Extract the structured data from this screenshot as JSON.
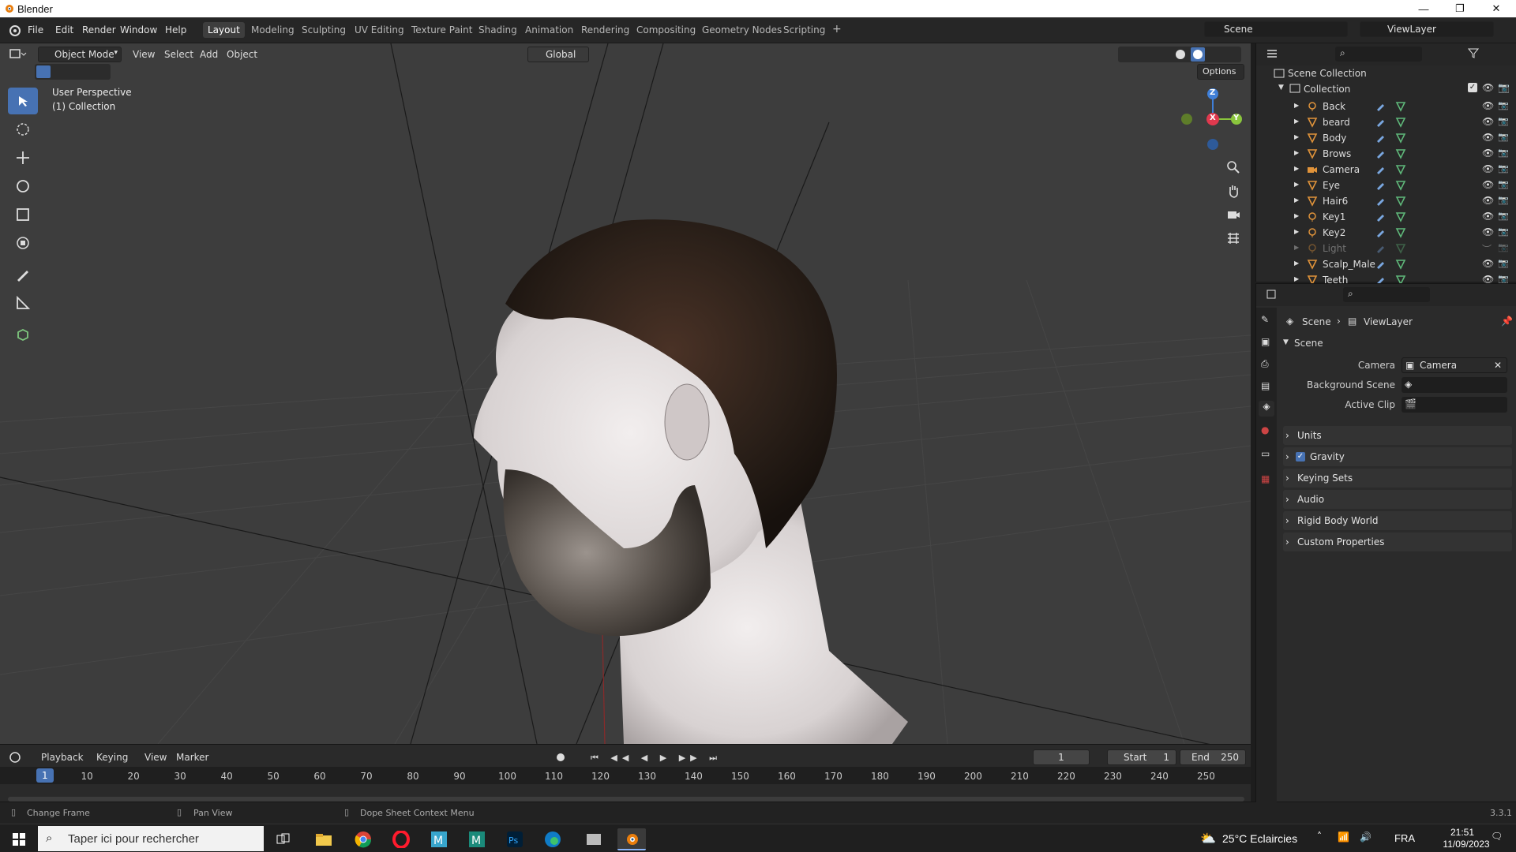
{
  "window": {
    "title": "Blender"
  },
  "menus": [
    "File",
    "Edit",
    "Render",
    "Window",
    "Help"
  ],
  "workspaces": [
    "Layout",
    "Modeling",
    "Sculpting",
    "UV Editing",
    "Texture Paint",
    "Shading",
    "Animation",
    "Rendering",
    "Compositing",
    "Geometry Nodes",
    "Scripting"
  ],
  "active_workspace": "Layout",
  "scene_name": "Scene",
  "view_layer_name": "ViewLayer",
  "viewport_header": {
    "mode": "Object Mode",
    "menus": [
      "View",
      "Select",
      "Add",
      "Object"
    ],
    "orientation": "Global",
    "options_label": "Options"
  },
  "viewport_overlay": {
    "perspective": "User Perspective",
    "collection": "(1) Collection"
  },
  "gizmo": {
    "z": "Z",
    "y": "Y",
    "x": "X"
  },
  "timeline": {
    "menus": [
      "Playback",
      "Keying",
      "View",
      "Marker"
    ],
    "current_frame": "1",
    "start_label": "Start",
    "start": "1",
    "end_label": "End",
    "end": "250",
    "ticks": [
      "1",
      "10",
      "20",
      "30",
      "40",
      "50",
      "60",
      "70",
      "80",
      "90",
      "100",
      "110",
      "120",
      "130",
      "140",
      "150",
      "160",
      "170",
      "180",
      "190",
      "200",
      "210",
      "220",
      "230",
      "240",
      "250"
    ]
  },
  "statusbar": {
    "left": "Change Frame",
    "middle": "Pan View",
    "right": "Dope Sheet Context Menu",
    "version": "3.3.1"
  },
  "outliner": {
    "root": "Scene Collection",
    "collection": "Collection",
    "items": [
      {
        "name": "Back",
        "type": "light"
      },
      {
        "name": "beard",
        "type": "mesh"
      },
      {
        "name": "Body",
        "type": "mesh"
      },
      {
        "name": "Brows",
        "type": "mesh"
      },
      {
        "name": "Camera",
        "type": "camera"
      },
      {
        "name": "Eye",
        "type": "mesh"
      },
      {
        "name": "Hair6",
        "type": "mesh"
      },
      {
        "name": "Key1",
        "type": "light"
      },
      {
        "name": "Key2",
        "type": "light"
      },
      {
        "name": "Light",
        "type": "light",
        "hidden": true
      },
      {
        "name": "Scalp_Male",
        "type": "mesh"
      },
      {
        "name": "Teeth",
        "type": "mesh"
      }
    ]
  },
  "properties": {
    "breadcrumb": [
      "Scene",
      "ViewLayer"
    ],
    "panel_title": "Scene",
    "camera_label": "Camera",
    "camera_value": "Camera",
    "background_scene_label": "Background Scene",
    "active_clip_label": "Active Clip",
    "sections": [
      "Units",
      "Gravity",
      "Keying Sets",
      "Audio",
      "Rigid Body World",
      "Custom Properties"
    ],
    "gravity_checked": true
  },
  "taskbar": {
    "search_placeholder": "Taper ici pour rechercher",
    "weather": "25°C  Eclaircies",
    "language": "FRA",
    "time": "21:51",
    "date": "11/09/2023"
  },
  "colors": {
    "accent": "#4772b3",
    "mesh_icon": "#e0933a",
    "data_icon": "#5fb87a",
    "x_axis": "#e0394e",
    "y_axis": "#8ac53d",
    "z_axis": "#3f7fd8"
  }
}
